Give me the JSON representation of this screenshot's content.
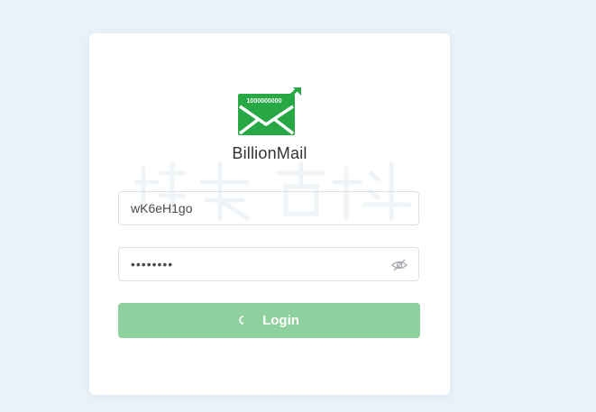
{
  "brand": {
    "name": "BillionMail",
    "logo_badge": "1000000000",
    "logo_color": "#28a745"
  },
  "form": {
    "username": {
      "value": "wK6eH1go"
    },
    "password": {
      "masked_value": "••••••••"
    },
    "login_label": "Login",
    "visibility_icon": "eye-off-icon"
  },
  "colors": {
    "background": "#eaf2f8",
    "card": "#ffffff",
    "button": "#8fd19e",
    "border": "#dcdfe6"
  }
}
